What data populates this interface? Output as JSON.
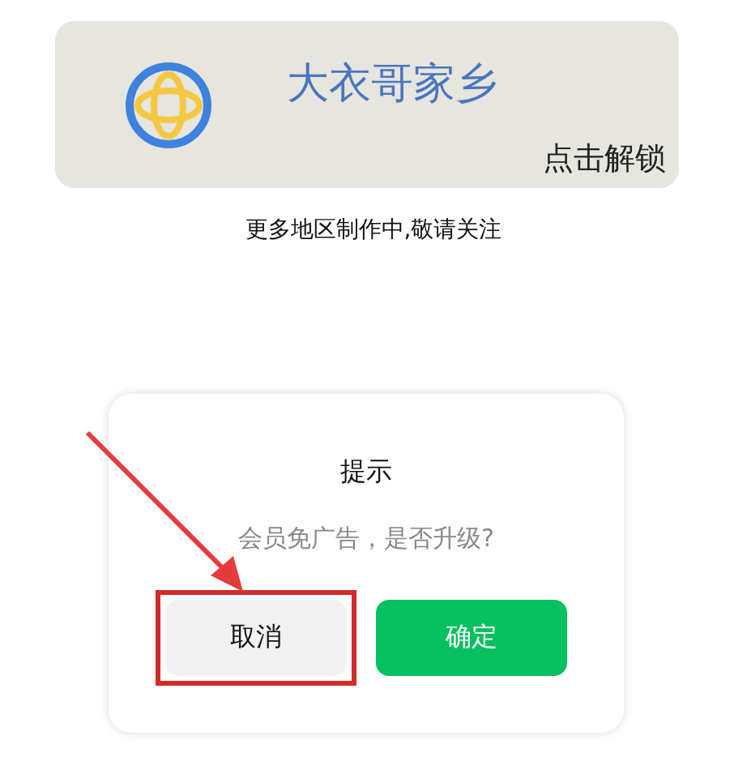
{
  "card": {
    "title": "大衣哥家乡",
    "action": "点击解锁"
  },
  "notice": "更多地区制作中,敬请关注",
  "dialog": {
    "title": "提示",
    "message": "会员免广告，是否升级?",
    "buttons": [
      {
        "kind": "cancel",
        "label": "取消",
        "highlighted": true
      },
      {
        "kind": "confirm",
        "label": "确定",
        "highlighted": false
      }
    ]
  }
}
